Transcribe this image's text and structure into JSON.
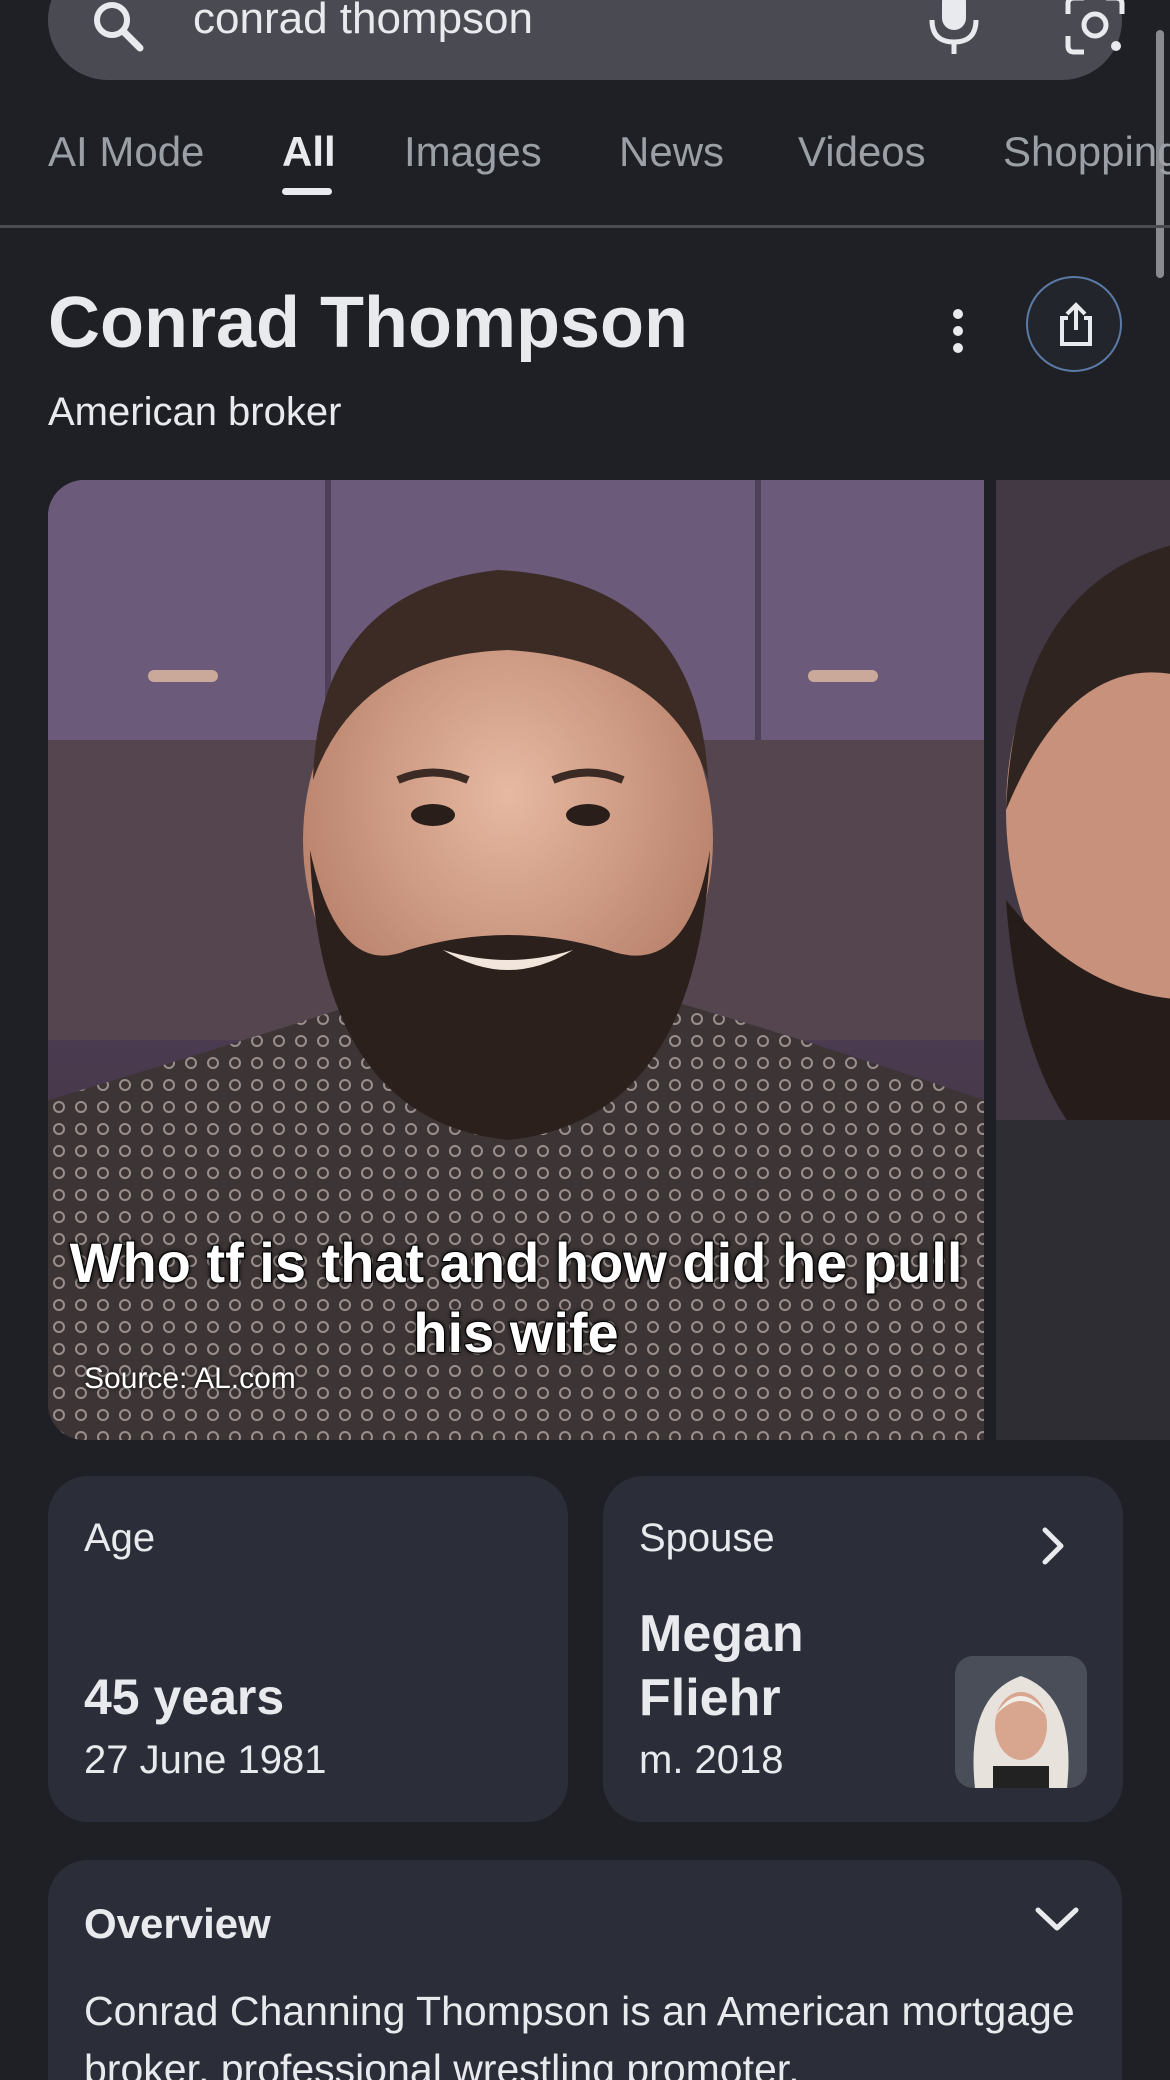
{
  "search": {
    "query": "conrad thompson",
    "icon": "search-icon"
  },
  "tabs": [
    {
      "label": "AI Mode",
      "active": false
    },
    {
      "label": "All",
      "active": true
    },
    {
      "label": "Images",
      "active": false
    },
    {
      "label": "News",
      "active": false
    },
    {
      "label": "Videos",
      "active": false
    },
    {
      "label": "Shopping",
      "active": false
    }
  ],
  "entity": {
    "title": "Conrad Thompson",
    "subtitle": "American broker"
  },
  "image": {
    "caption": "Who tf is that and how did he pull his wife",
    "source": "Source: AL.com"
  },
  "age_card": {
    "label": "Age",
    "value": "45 years",
    "date": "27 June 1981"
  },
  "spouse_card": {
    "label": "Spouse",
    "name": "Megan Fliehr",
    "married": "m. 2018"
  },
  "overview": {
    "title": "Overview",
    "text": "Conrad Channing Thompson is an American mortgage broker, professional wrestling promoter,"
  },
  "colors": {
    "background": "#1f2025",
    "card": "#2b2e38",
    "search_bar": "#4a4b52",
    "text": "#e8eaed",
    "muted_text": "#9aa0a6"
  }
}
